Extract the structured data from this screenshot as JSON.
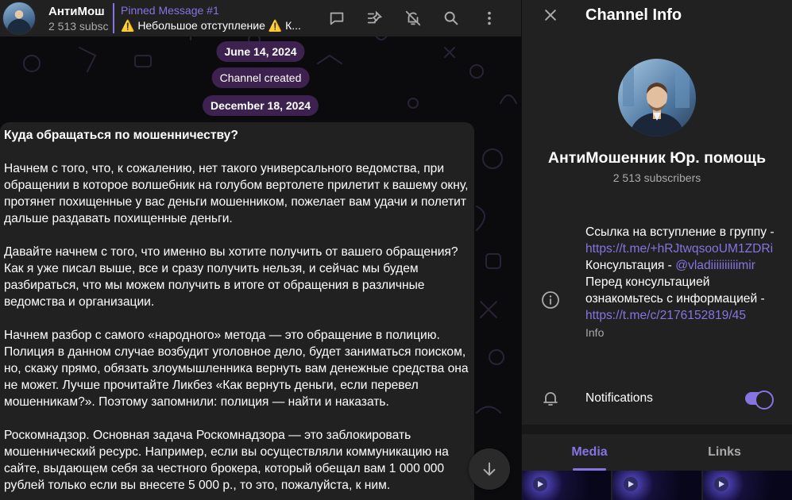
{
  "colors": {
    "accent": "#8774e1",
    "panel": "#212121",
    "date_pill": "#422454",
    "chat_bg": "#0b0b0d"
  },
  "header": {
    "title": "АнтиМош",
    "subtitle": "2 513 subsc",
    "pinned_title": "Pinned Message #1",
    "pinned_text": "⚠️ Небольшое отступление ⚠️ К...",
    "icons": [
      "comments-icon",
      "manage-pins-icon",
      "mute-icon",
      "search-icon",
      "more-icon"
    ]
  },
  "chat": {
    "dates": [
      "June 14, 2024",
      "December 18, 2024"
    ],
    "service_message": "Channel created",
    "message": {
      "heading": "Куда обращаться по мошенничеству?",
      "p1": "Начнем с того, что, к сожалению, нет такого универсального ведомства, при обращении в которое волшебник на голубом вертолете прилетит к вашему окну, протянет похищенные у вас деньги мошенником, пожелает вам удачи и полетит дальше раздавать похищенные деньги.",
      "p2": "Давайте начнем с того, что именно вы хотите получить от вашего обращения? Как я уже писал выше, все и сразу получить нельзя, и сейчас мы будем разбираться, что мы можем получить в итоге от обращения в различные ведомства и организации.",
      "p3": "Начнем разбор с самого «народного» метода — это обращение в полицию. Полиция в данном случае возбудит уголовное дело, будет заниматься поиском, но, скажу прямо, обязать злоумышленника вернуть вам денежные средства она не может. Лучше прочитайте Ликбез «Как вернуть деньги, если перевел мошенникам?». Поэтому запомнили: полиция — найти и наказать.",
      "p4": "Роскомнадзор. Основная задача Роскомнадзора — это заблокировать мошеннический ресурс. Например, если вы осуществляли коммуникацию на сайте, выдающем себя за честного брокера, который обещал вам 1 000 000 рублей только если вы внесете 5 000 р., то это, пожалуйста, к ним."
    }
  },
  "info": {
    "title": "Channel Info",
    "name": "АнтиМошенник Юр. помощь",
    "subscribers": "2 513 subscribers",
    "desc": {
      "line1": "Ссылка на вступление в группу -",
      "link1": "https://t.me/+hRJtwqsooUM1ZDRi",
      "consult_prefix": "Консультация - ",
      "consult_link": "@vladiiiiiiiiiimir",
      "line3": "Перед консультацией ознакомьтесь с информацией -",
      "link2": "https://t.me/c/2176152819/45"
    },
    "desc_caption": "Info",
    "notifications_label": "Notifications",
    "notifications_on": true,
    "tabs": [
      "Media",
      "Links"
    ]
  }
}
